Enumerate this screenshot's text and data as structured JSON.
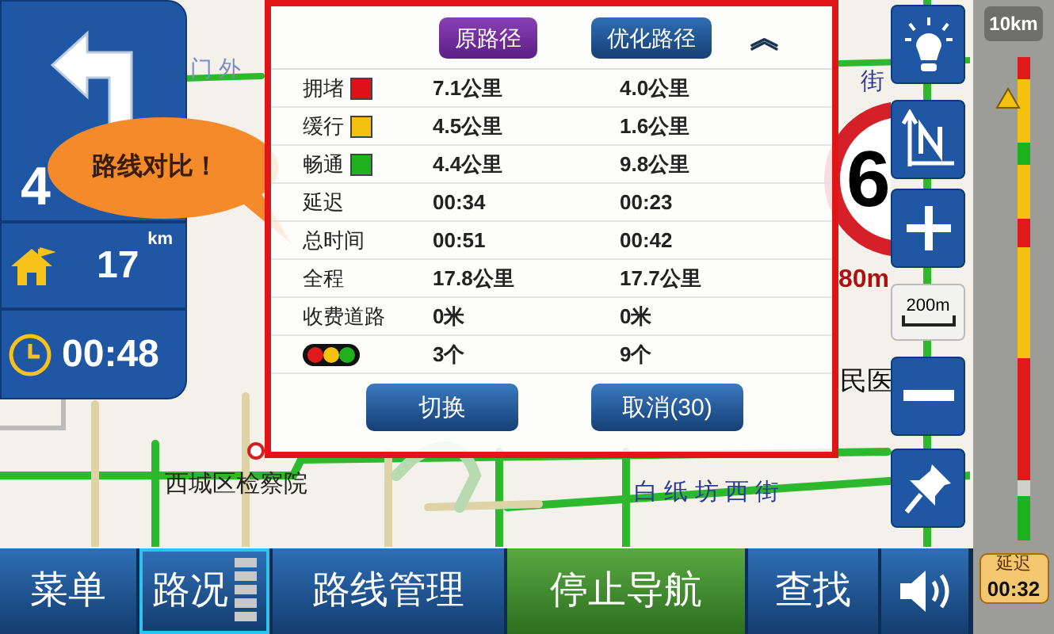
{
  "map": {
    "labels": [
      {
        "text": "西城区检察院"
      },
      {
        "text": "白 纸 坊 西 街"
      },
      {
        "text": "民医"
      },
      {
        "text": "门 外"
      },
      {
        "text": "街"
      }
    ]
  },
  "guidance": {
    "distance": "4",
    "unit": "km",
    "remaining": "17",
    "time": "00:48"
  },
  "bubble": {
    "text": "路线对比！"
  },
  "compare": {
    "routes": [
      {
        "label": "原路径",
        "selected": true
      },
      {
        "label": "优化路径",
        "selected": false
      }
    ],
    "collapse": "︽",
    "rows": [
      {
        "kind": "traffic",
        "label": "拥堵",
        "color": "#e0101a",
        "values": [
          "7.1公里",
          "4.0公里"
        ]
      },
      {
        "kind": "traffic",
        "label": "缓行",
        "color": "#f2c20f",
        "values": [
          "4.5公里",
          "1.6公里"
        ]
      },
      {
        "kind": "traffic",
        "label": "畅通",
        "color": "#1fb21f",
        "values": [
          "4.4公里",
          "9.8公里"
        ]
      },
      {
        "kind": "text",
        "label": "延迟",
        "values": [
          "00:34",
          "00:23"
        ]
      },
      {
        "kind": "text",
        "label": "总时间",
        "values": [
          "00:51",
          "00:42"
        ]
      },
      {
        "kind": "text",
        "label": "全程",
        "values": [
          "17.8公里",
          "17.7公里"
        ]
      },
      {
        "kind": "text",
        "label": "收费道路",
        "values": [
          "0米",
          "0米"
        ]
      },
      {
        "kind": "lights",
        "values": [
          "3个",
          "9个"
        ]
      }
    ],
    "buttons": [
      "切换",
      "取消(30)"
    ]
  },
  "speed_sign": {
    "value": "6",
    "distance": "80m"
  },
  "scale": "200m",
  "traffic_bar": {
    "range": "10km",
    "delay_label": "延迟",
    "delay": "00:32"
  },
  "bottom_bar": [
    {
      "kind": "text",
      "label": "菜单",
      "selected": false
    },
    {
      "kind": "toggle",
      "label": "路况",
      "selected": true
    },
    {
      "kind": "text",
      "label": "路线管理",
      "selected": false
    },
    {
      "kind": "stop",
      "label": "停止导航",
      "selected": false
    },
    {
      "kind": "text",
      "label": "查找",
      "selected": false
    }
  ]
}
